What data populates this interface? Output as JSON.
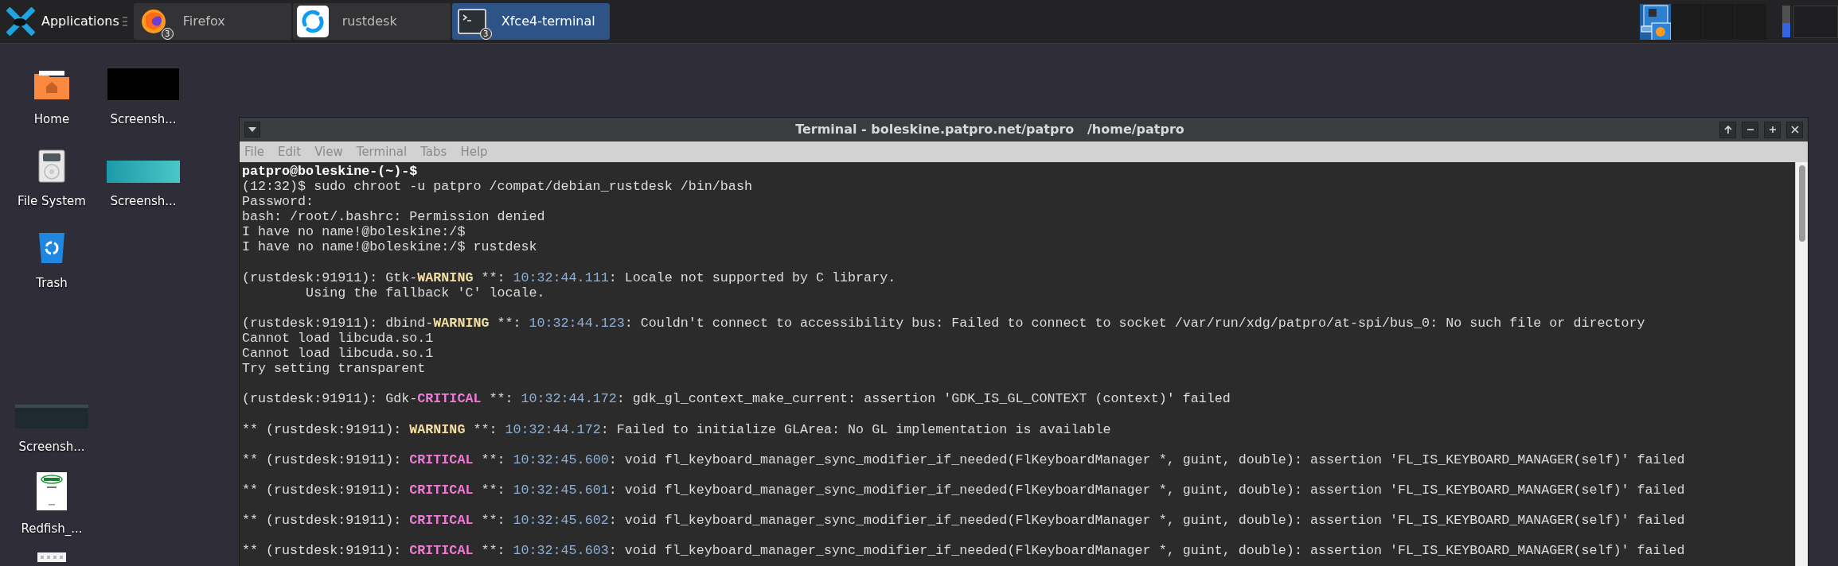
{
  "taskbar": {
    "menu_label": "Applications",
    "tasks": [
      {
        "label": "Firefox",
        "kind": "firefox",
        "badge": "3",
        "selected": false
      },
      {
        "label": "rustdesk",
        "kind": "rustdesk",
        "selected": false
      },
      {
        "label": "Xfce4-terminal",
        "kind": "terminal",
        "badge": "3",
        "selected": true
      }
    ],
    "workspaces": [
      {
        "selected": true
      },
      {
        "selected": false
      },
      {
        "selected": false
      },
      {
        "selected": false
      }
    ],
    "cpu_meter": {
      "level": 0.45
    }
  },
  "desktop_icons": [
    {
      "label": "Home",
      "kind": "folder"
    },
    {
      "label": "Screensh...",
      "kind": "dark-thumbnail"
    },
    {
      "label": "File System",
      "kind": "drive"
    },
    {
      "label": "Screensh...",
      "kind": "teal-thumbnail"
    },
    {
      "label": "Trash",
      "kind": "trash"
    },
    {
      "label": "Screensh...",
      "kind": "table-thumbnail"
    },
    {
      "label": "Redfish_...",
      "kind": "document"
    },
    {
      "kind": "image"
    }
  ],
  "terminal": {
    "title": "Terminal - boleskine.patpro.net/patpro   /home/patpro",
    "menu": [
      "File",
      "Edit",
      "View",
      "Terminal",
      "Tabs",
      "Help"
    ],
    "lines": [
      {
        "kind": "text",
        "segments": [
          {
            "kind": "prompt",
            "text": "patpro@boleskine-(~)-$"
          }
        ]
      },
      {
        "kind": "text",
        "segments": [
          {
            "kind": "plain",
            "text": "(12:32)$ sudo chroot -u patpro /compat/debian_rustdesk /bin/bash"
          }
        ]
      },
      {
        "kind": "text",
        "segments": [
          {
            "kind": "plain",
            "text": "Password:"
          }
        ]
      },
      {
        "kind": "text",
        "segments": [
          {
            "kind": "plain",
            "text": "bash: /root/.bashrc: Permission denied"
          }
        ]
      },
      {
        "kind": "text",
        "segments": [
          {
            "kind": "plain",
            "text": "I have no name!@boleskine:/$"
          }
        ]
      },
      {
        "kind": "text",
        "segments": [
          {
            "kind": "plain",
            "text": "I have no name!@boleskine:/$ rustdesk"
          }
        ]
      },
      {
        "kind": "gap"
      },
      {
        "kind": "text",
        "segments": [
          {
            "kind": "plain",
            "text": "(rustdesk:91911): Gtk-"
          },
          {
            "kind": "warning",
            "text": "WARNING"
          },
          {
            "kind": "plain",
            "text": " **: "
          },
          {
            "kind": "time",
            "text": "10:32:44.111"
          },
          {
            "kind": "plain",
            "text": ": Locale not supported by C library."
          }
        ]
      },
      {
        "kind": "text",
        "segments": [
          {
            "kind": "plain",
            "text": "        Using the fallback 'C' locale."
          }
        ]
      },
      {
        "kind": "gap"
      },
      {
        "kind": "text",
        "segments": [
          {
            "kind": "plain",
            "text": "(rustdesk:91911): dbind-"
          },
          {
            "kind": "warning",
            "text": "WARNING"
          },
          {
            "kind": "plain",
            "text": " **: "
          },
          {
            "kind": "time",
            "text": "10:32:44.123"
          },
          {
            "kind": "plain",
            "text": ": Couldn't connect to accessibility bus: Failed to connect to socket /var/run/xdg/patpro/at-spi/bus_0: No such file or directory"
          }
        ]
      },
      {
        "kind": "text",
        "segments": [
          {
            "kind": "plain",
            "text": "Cannot load libcuda.so.1"
          }
        ]
      },
      {
        "kind": "text",
        "segments": [
          {
            "kind": "plain",
            "text": "Cannot load libcuda.so.1"
          }
        ]
      },
      {
        "kind": "text",
        "segments": [
          {
            "kind": "plain",
            "text": "Try setting transparent"
          }
        ]
      },
      {
        "kind": "gap"
      },
      {
        "kind": "text",
        "segments": [
          {
            "kind": "plain",
            "text": "(rustdesk:91911): Gdk-"
          },
          {
            "kind": "critical",
            "text": "CRITICAL"
          },
          {
            "kind": "plain",
            "text": " **: "
          },
          {
            "kind": "time",
            "text": "10:32:44.172"
          },
          {
            "kind": "plain",
            "text": ": gdk_gl_context_make_current: assertion 'GDK_IS_GL_CONTEXT (context)' failed"
          }
        ]
      },
      {
        "kind": "gap"
      },
      {
        "kind": "text",
        "segments": [
          {
            "kind": "plain",
            "text": "** (rustdesk:91911): "
          },
          {
            "kind": "warning",
            "text": "WARNING"
          },
          {
            "kind": "plain",
            "text": " **: "
          },
          {
            "kind": "time",
            "text": "10:32:44.172"
          },
          {
            "kind": "plain",
            "text": ": Failed to initialize GLArea: No GL implementation is available"
          }
        ]
      },
      {
        "kind": "gap"
      },
      {
        "kind": "text",
        "segments": [
          {
            "kind": "plain",
            "text": "** (rustdesk:91911): "
          },
          {
            "kind": "critical",
            "text": "CRITICAL"
          },
          {
            "kind": "plain",
            "text": " **: "
          },
          {
            "kind": "time",
            "text": "10:32:45.600"
          },
          {
            "kind": "plain",
            "text": ": void fl_keyboard_manager_sync_modifier_if_needed(FlKeyboardManager *, guint, double): assertion 'FL_IS_KEYBOARD_MANAGER(self)' failed"
          }
        ]
      },
      {
        "kind": "gap"
      },
      {
        "kind": "text",
        "segments": [
          {
            "kind": "plain",
            "text": "** (rustdesk:91911): "
          },
          {
            "kind": "critical",
            "text": "CRITICAL"
          },
          {
            "kind": "plain",
            "text": " **: "
          },
          {
            "kind": "time",
            "text": "10:32:45.601"
          },
          {
            "kind": "plain",
            "text": ": void fl_keyboard_manager_sync_modifier_if_needed(FlKeyboardManager *, guint, double): assertion 'FL_IS_KEYBOARD_MANAGER(self)' failed"
          }
        ]
      },
      {
        "kind": "gap"
      },
      {
        "kind": "text",
        "segments": [
          {
            "kind": "plain",
            "text": "** (rustdesk:91911): "
          },
          {
            "kind": "critical",
            "text": "CRITICAL"
          },
          {
            "kind": "plain",
            "text": " **: "
          },
          {
            "kind": "time",
            "text": "10:32:45.602"
          },
          {
            "kind": "plain",
            "text": ": void fl_keyboard_manager_sync_modifier_if_needed(FlKeyboardManager *, guint, double): assertion 'FL_IS_KEYBOARD_MANAGER(self)' failed"
          }
        ]
      },
      {
        "kind": "gap"
      },
      {
        "kind": "text",
        "segments": [
          {
            "kind": "plain",
            "text": "** (rustdesk:91911): "
          },
          {
            "kind": "critical",
            "text": "CRITICAL"
          },
          {
            "kind": "plain",
            "text": " **: "
          },
          {
            "kind": "time",
            "text": "10:32:45.603"
          },
          {
            "kind": "plain",
            "text": ": void fl_keyboard_manager_sync_modifier_if_needed(FlKeyboardManager *, guint, double): assertion 'FL_IS_KEYBOARD_MANAGER(self)' failed"
          }
        ]
      }
    ]
  }
}
